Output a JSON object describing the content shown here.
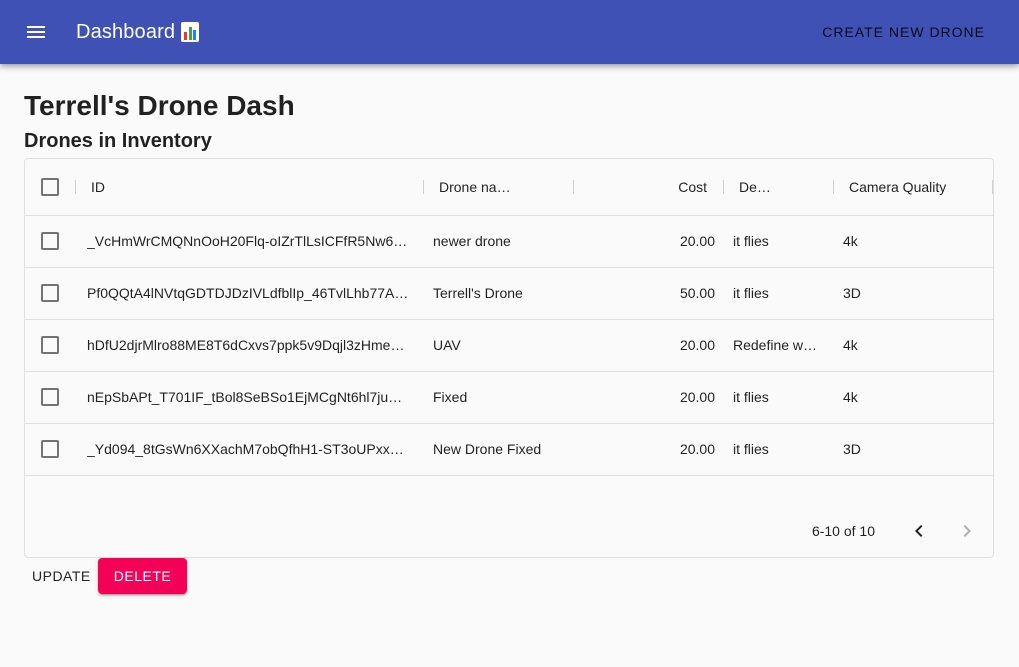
{
  "appbar": {
    "title": "Dashboard",
    "title_icon": "bar-chart-emoji-icon",
    "menu_icon": "menu-icon",
    "create_label": "CREATE NEW DRONE"
  },
  "page": {
    "title": "Terrell's Drone Dash",
    "section_title": "Drones in Inventory"
  },
  "table": {
    "headers": {
      "id": "ID",
      "name": "Drone na…",
      "cost": "Cost",
      "description": "De…",
      "camera": "Camera Quality"
    },
    "rows": [
      {
        "id": "_VcHmWrCMQNnOoH20Flq-oIZrTlLsICFfR5Nw6…",
        "name": "newer drone",
        "cost": "20.00",
        "description": "it flies",
        "camera": "4k"
      },
      {
        "id": "Pf0QQtA4lNVtqGDTDJDzIVLdfblIp_46TvlLhb77A…",
        "name": "Terrell's Drone",
        "cost": "50.00",
        "description": "it flies",
        "camera": "3D"
      },
      {
        "id": "hDfU2djrMlro88ME8T6dCxvs7ppk5v9Dqjl3zHme…",
        "name": "UAV",
        "cost": "20.00",
        "description": "Redefine w…",
        "camera": "4k"
      },
      {
        "id": "nEpSbAPt_T701IF_tBol8SeBSo1EjMCgNt6hl7ju…",
        "name": "Fixed",
        "cost": "20.00",
        "description": "it flies",
        "camera": "4k"
      },
      {
        "id": "_Yd094_8tGsWn6XXachM7obQfhH1-ST3oUPxx…",
        "name": "New Drone Fixed",
        "cost": "20.00",
        "description": "it flies",
        "camera": "3D"
      }
    ],
    "pagination": "6-10 of 10"
  },
  "actions": {
    "update_label": "UPDATE",
    "delete_label": "DELETE",
    "delete_color": "#f50057"
  },
  "colors": {
    "appbar": "#3f51b5"
  }
}
